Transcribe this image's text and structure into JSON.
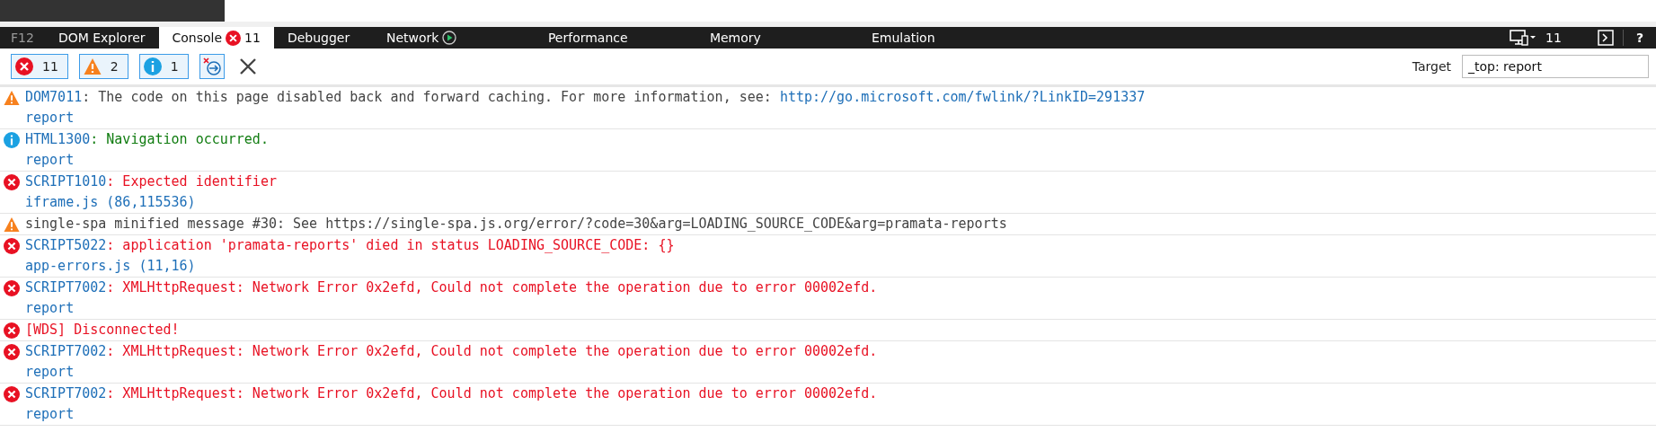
{
  "tabs": [
    {
      "label": "F12",
      "kind": "brand",
      "selected": false
    },
    {
      "label": "DOM Explorer",
      "kind": "plain",
      "selected": false
    },
    {
      "label": "Console",
      "kind": "errors",
      "badge": "11",
      "selected": true
    },
    {
      "label": "Debugger",
      "kind": "plain",
      "selected": false
    },
    {
      "label": "Network",
      "kind": "play",
      "selected": false
    },
    {
      "label": "Performance",
      "kind": "plain",
      "selected": false
    },
    {
      "label": "Memory",
      "kind": "plain",
      "selected": false
    },
    {
      "label": "Emulation",
      "kind": "plain",
      "selected": false
    }
  ],
  "tab_bar_right": {
    "emulation_count": "11",
    "help": "?"
  },
  "filters": [
    {
      "kind": "error",
      "count": "11",
      "selected": true
    },
    {
      "kind": "warning",
      "count": "2",
      "selected": true
    },
    {
      "kind": "info",
      "count": "1",
      "selected": true
    }
  ],
  "target": {
    "label": "Target",
    "value": "_top: report"
  },
  "messages": [
    {
      "kind": "warning",
      "code": "DOM7011",
      "text": ": The code on this page disabled back and forward caching. For more information, see: ",
      "link": "http://go.microsoft.com/fwlink/?LinkID=291337",
      "source": "report"
    },
    {
      "kind": "info",
      "code": "HTML1300",
      "text": ": Navigation occurred.",
      "source": "report"
    },
    {
      "kind": "error",
      "code": "SCRIPT1010",
      "text": ": Expected identifier",
      "source": "iframe.js (86,115536)"
    },
    {
      "kind": "warning",
      "text": "single-spa minified message #30: See https://single-spa.js.org/error/?code=30&arg=LOADING_SOURCE_CODE&arg=pramata-reports"
    },
    {
      "kind": "error",
      "code": "SCRIPT5022",
      "text": ": application 'pramata-reports' died in status LOADING_SOURCE_CODE: {}",
      "source": "app-errors.js (11,16)"
    },
    {
      "kind": "error",
      "code": "SCRIPT7002",
      "text": ": XMLHttpRequest: Network Error 0x2efd, Could not complete the operation due to error 00002efd.",
      "source": "report"
    },
    {
      "kind": "error",
      "text": "[WDS] Disconnected!"
    },
    {
      "kind": "error",
      "code": "SCRIPT7002",
      "text": ": XMLHttpRequest: Network Error 0x2efd, Could not complete the operation due to error 00002efd.",
      "source": "report"
    },
    {
      "kind": "error",
      "code": "SCRIPT7002",
      "text": ": XMLHttpRequest: Network Error 0x2efd, Could not complete the operation due to error 00002efd.",
      "source": "report"
    }
  ]
}
